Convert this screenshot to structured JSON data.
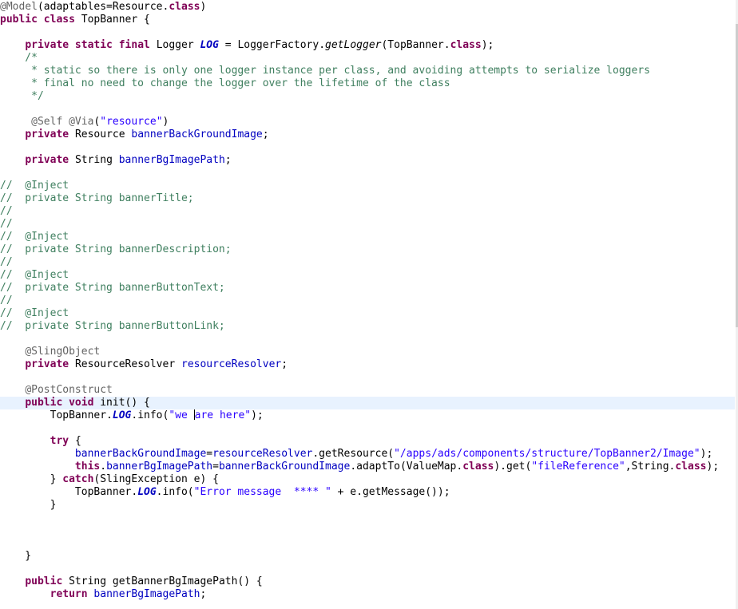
{
  "editor": {
    "lines": [
      [
        [
          "ann",
          "@Model"
        ],
        [
          "p",
          "(adaptables=Resource."
        ],
        [
          "kw",
          "class"
        ],
        [
          "p",
          ")"
        ]
      ],
      [
        [
          "kw",
          "public class "
        ],
        [
          "p",
          "TopBanner {"
        ]
      ],
      [],
      [
        [
          "p",
          "    "
        ],
        [
          "kw",
          "private static final "
        ],
        [
          "p",
          "Logger "
        ],
        [
          "sfld",
          "LOG"
        ],
        [
          "p",
          " = LoggerFactory."
        ],
        [
          "smeth",
          "getLogger"
        ],
        [
          "p",
          "(TopBanner."
        ],
        [
          "kw",
          "class"
        ],
        [
          "p",
          ");"
        ]
      ],
      [
        [
          "cm",
          "    /*"
        ]
      ],
      [
        [
          "cm",
          "     * static so there is only one logger instance per class, and avoiding attempts to serialize loggers"
        ]
      ],
      [
        [
          "cm",
          "     * final no need to change the logger over the lifetime of the class"
        ]
      ],
      [
        [
          "cm",
          "     */"
        ]
      ],
      [],
      [
        [
          "p",
          "     "
        ],
        [
          "ann",
          "@Self @Via"
        ],
        [
          "p",
          "("
        ],
        [
          "st",
          "\"resource\""
        ],
        [
          "p",
          ")"
        ]
      ],
      [
        [
          "p",
          "    "
        ],
        [
          "kw",
          "private "
        ],
        [
          "p",
          "Resource "
        ],
        [
          "fld",
          "bannerBackGroundImage"
        ],
        [
          "p",
          ";"
        ]
      ],
      [],
      [
        [
          "p",
          "    "
        ],
        [
          "kw",
          "private "
        ],
        [
          "p",
          "String "
        ],
        [
          "fld",
          "bannerBgImagePath"
        ],
        [
          "p",
          ";"
        ]
      ],
      [],
      [
        [
          "cm",
          "//  @Inject"
        ]
      ],
      [
        [
          "cm",
          "//  private String bannerTitle;"
        ]
      ],
      [
        [
          "cm",
          "//"
        ]
      ],
      [
        [
          "cm",
          "//"
        ]
      ],
      [
        [
          "cm",
          "//  @Inject"
        ]
      ],
      [
        [
          "cm",
          "//  private String bannerDescription;"
        ]
      ],
      [
        [
          "cm",
          "//"
        ]
      ],
      [
        [
          "cm",
          "//  @Inject"
        ]
      ],
      [
        [
          "cm",
          "//  private String bannerButtonText;"
        ]
      ],
      [
        [
          "cm",
          "//"
        ]
      ],
      [
        [
          "cm",
          "//  @Inject"
        ]
      ],
      [
        [
          "cm",
          "//  private String bannerButtonLink;"
        ]
      ],
      [],
      [
        [
          "p",
          "    "
        ],
        [
          "ann",
          "@SlingObject"
        ]
      ],
      [
        [
          "p",
          "    "
        ],
        [
          "kw",
          "private "
        ],
        [
          "p",
          "ResourceResolver "
        ],
        [
          "fld",
          "resourceResolver"
        ],
        [
          "p",
          ";"
        ]
      ],
      [],
      [
        [
          "p",
          "    "
        ],
        [
          "ann",
          "@PostConstruct"
        ]
      ],
      [
        [
          "p",
          "    "
        ],
        [
          "kw",
          "public void "
        ],
        [
          "p",
          "init() {"
        ]
      ],
      [
        [
          "p",
          "        TopBanner."
        ],
        [
          "sfld",
          "LOG"
        ],
        [
          "p",
          ".info("
        ],
        [
          "st",
          "\"we "
        ],
        [
          "caret",
          ""
        ],
        [
          "st",
          "are here\""
        ],
        [
          "p",
          ");"
        ]
      ],
      [],
      [
        [
          "p",
          "        "
        ],
        [
          "kw",
          "try "
        ],
        [
          "p",
          "{"
        ]
      ],
      [
        [
          "p",
          "            "
        ],
        [
          "fld",
          "bannerBackGroundImage"
        ],
        [
          "p",
          "="
        ],
        [
          "fld",
          "resourceResolver"
        ],
        [
          "p",
          ".getResource("
        ],
        [
          "st",
          "\"/apps/ads/components/structure/TopBanner2/Image\""
        ],
        [
          "p",
          ");"
        ]
      ],
      [
        [
          "p",
          "            "
        ],
        [
          "kw",
          "this"
        ],
        [
          "p",
          "."
        ],
        [
          "fld",
          "bannerBgImagePath"
        ],
        [
          "p",
          "="
        ],
        [
          "fld",
          "bannerBackGroundImage"
        ],
        [
          "p",
          ".adaptTo(ValueMap."
        ],
        [
          "kw",
          "class"
        ],
        [
          "p",
          ").get("
        ],
        [
          "st",
          "\"fileReference\""
        ],
        [
          "p",
          ",String."
        ],
        [
          "kw",
          "class"
        ],
        [
          "p",
          ");"
        ]
      ],
      [
        [
          "p",
          "        } "
        ],
        [
          "kw",
          "catch"
        ],
        [
          "p",
          "(SlingException e) {"
        ]
      ],
      [
        [
          "p",
          "            TopBanner."
        ],
        [
          "sfld",
          "LOG"
        ],
        [
          "p",
          ".info("
        ],
        [
          "st",
          "\"Error message  **** \""
        ],
        [
          "p",
          " + e.getMessage());"
        ]
      ],
      [
        [
          "p",
          "        }"
        ]
      ],
      [],
      [],
      [],
      [
        [
          "p",
          "    }"
        ]
      ],
      [],
      [
        [
          "p",
          "    "
        ],
        [
          "kw",
          "public "
        ],
        [
          "p",
          "String getBannerBgImagePath() {"
        ]
      ],
      [
        [
          "p",
          "        "
        ],
        [
          "kw",
          "return "
        ],
        [
          "fld",
          "bannerBgImagePath"
        ],
        [
          "p",
          ";"
        ]
      ]
    ],
    "current_line": 32
  }
}
